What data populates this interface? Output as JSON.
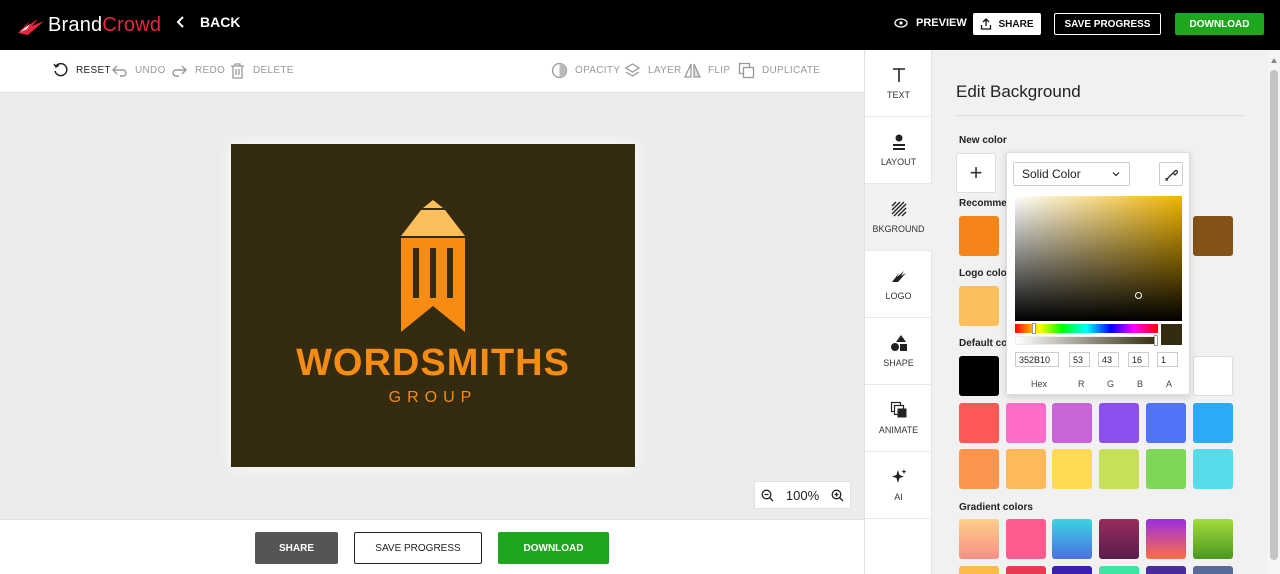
{
  "brand": {
    "name_part1": "Brand",
    "name_part2": "Crowd",
    "accent": "#e8263d"
  },
  "topbar": {
    "back_label": "BACK",
    "preview_label": "PREVIEW",
    "share_label": "SHARE",
    "save_label": "SAVE PROGRESS",
    "download_label": "DOWNLOAD"
  },
  "toolbar": {
    "reset": "RESET",
    "undo": "UNDO",
    "redo": "REDO",
    "delete": "DELETE",
    "opacity": "OPACITY",
    "layer": "LAYER",
    "flip": "FLIP",
    "duplicate": "DUPLICATE"
  },
  "canvas": {
    "background_color": "#352b10",
    "logo_name": "WORDSMITHS",
    "logo_tagline": "GROUP",
    "logo_color": "#f78c14"
  },
  "zoom": {
    "level": "100%"
  },
  "bottombar": {
    "share_label": "SHARE",
    "save_label": "SAVE PROGRESS",
    "download_label": "DOWNLOAD"
  },
  "sidetools": [
    {
      "label": "TEXT",
      "icon": "text-icon"
    },
    {
      "label": "LAYOUT",
      "icon": "layout-icon"
    },
    {
      "label": "BKGROUND",
      "icon": "background-icon",
      "selected": true
    },
    {
      "label": "LOGO",
      "icon": "logo-icon"
    },
    {
      "label": "SHAPE",
      "icon": "shape-icon"
    },
    {
      "label": "ANIMATE",
      "icon": "animate-icon"
    },
    {
      "label": "AI",
      "icon": "ai-sparkle-icon"
    }
  ],
  "panel": {
    "title": "Edit Background",
    "new_color_label": "New color",
    "recommended_label": "Recommen",
    "logo_colors_label": "Logo color",
    "default_colors_label": "Default co",
    "gradient_colors_label": "Gradient colors",
    "recommended_swatches": [
      "#f7841a",
      "#845117"
    ],
    "logo_swatches": [
      "#fdbe5c"
    ],
    "default_swatches": [
      "#000000",
      "#ffffff"
    ],
    "color_row_1": [
      "#fc5858",
      "#fd6cc9",
      "#c964d9",
      "#8c50f0",
      "#5173f9",
      "#2aaaf7"
    ],
    "color_row_2": [
      "#fd954c",
      "#feb95a",
      "#fedb52",
      "#c6e05a",
      "#7ed857",
      "#58dbe8"
    ],
    "gradient_row": [
      [
        "#fdd08a",
        "#f98e86"
      ],
      [
        "#fe5c8d",
        "#fe5c8d"
      ],
      [
        "#3ad3e1",
        "#4b70e2"
      ],
      [
        "#962d5c",
        "#5a1d4c"
      ],
      [
        "#9a2ee1",
        "#fd6f45"
      ],
      [
        "#a3db3c",
        "#4a9820"
      ]
    ],
    "gradient_row_partial": [
      "#fdbb4c",
      "#e83a55",
      "#3a1fb0",
      "#3ee5a2",
      "#4a2b9e",
      "#5a6a98"
    ]
  },
  "picker": {
    "mode": "Solid Color",
    "hex": "352B10",
    "r": "53",
    "g": "43",
    "b": "16",
    "a": "1",
    "labels": {
      "hex": "Hex",
      "r": "R",
      "g": "G",
      "b": "B",
      "a": "A"
    },
    "hue_color": "#f0b400",
    "current_color": "#352b10"
  }
}
